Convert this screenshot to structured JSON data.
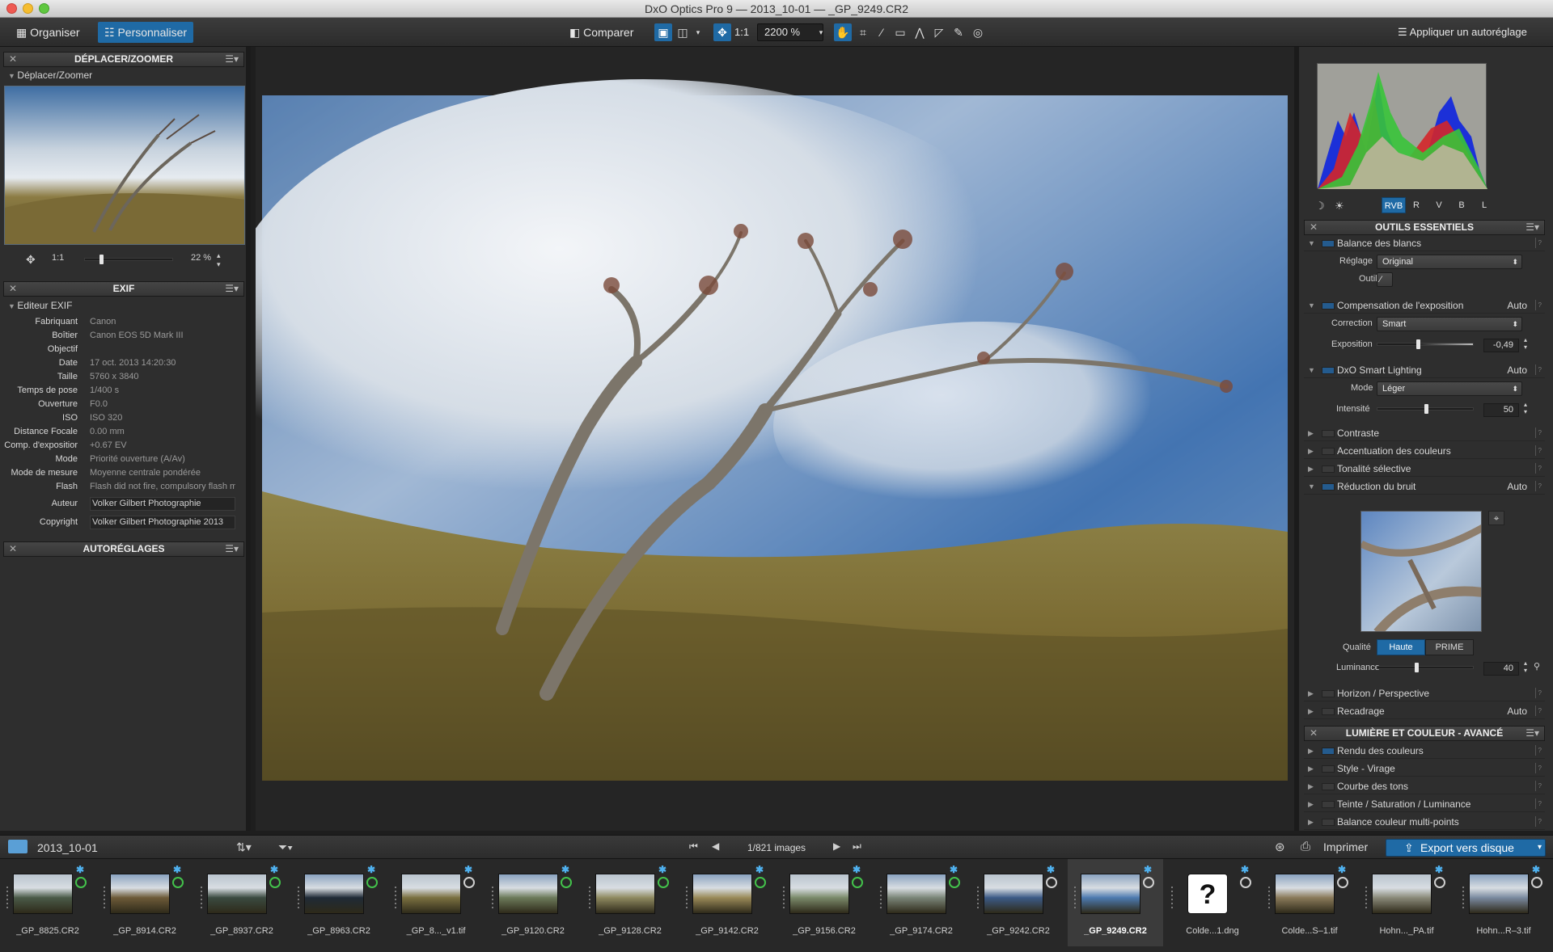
{
  "window": {
    "title": "DxO Optics Pro 9 — 2013_10-01 — _GP_9249.CR2"
  },
  "toolbar": {
    "organize_label": "Organiser",
    "customize_label": "Personnaliser",
    "compare_label": "Comparer",
    "zoom_fit": "1:1",
    "zoom_level": "2200 %",
    "auto_preset_label": "Appliquer un autoréglage"
  },
  "left": {
    "navigator": {
      "title": "DÉPLACER/ZOOMER",
      "sub": "Déplacer/Zoomer",
      "ratio": "1:1",
      "zoom": "22 %"
    },
    "exif": {
      "title": "EXIF",
      "sub": "Editeur EXIF",
      "rows": [
        {
          "k": "Fabriquant",
          "v": "Canon"
        },
        {
          "k": "Boîtier",
          "v": "Canon EOS 5D Mark III"
        },
        {
          "k": "Objectif",
          "v": ""
        },
        {
          "k": "Date",
          "v": "17 oct. 2013 14:20:30"
        },
        {
          "k": "Taille",
          "v": "5760 x 3840"
        },
        {
          "k": "Temps de pose",
          "v": "1/400 s"
        },
        {
          "k": "Ouverture",
          "v": "F0.0"
        },
        {
          "k": "ISO",
          "v": "ISO 320"
        },
        {
          "k": "Distance Focale",
          "v": "0.00 mm"
        },
        {
          "k": "Comp. d'expositior",
          "v": "+0.67 EV"
        },
        {
          "k": "Mode",
          "v": "Priorité ouverture (A/Av)"
        },
        {
          "k": "Mode de mesure",
          "v": "Moyenne centrale pondérée"
        },
        {
          "k": "Flash",
          "v": "Flash did not fire, compulsory flash mode"
        }
      ],
      "author_label": "Auteur",
      "author": "Volker Gilbert Photographie",
      "copyright_label": "Copyright",
      "copyright": "Volker Gilbert Photographie 2013"
    },
    "presets_title": "AUTORÉGLAGES"
  },
  "right": {
    "histogram_tabs": [
      "RVB",
      "R",
      "V",
      "B",
      "L"
    ],
    "essentials": {
      "title": "OUTILS ESSENTIELS",
      "white_balance": {
        "label": "Balance des blancs",
        "setting_label": "Réglage",
        "setting": "Original",
        "tool_label": "Outil"
      },
      "exposure": {
        "label": "Compensation de l'exposition",
        "auto": "Auto",
        "correction_label": "Correction",
        "correction": "Smart",
        "exposure_label": "Exposition",
        "exposure_value": "-0,49",
        "exposure_level": 0.42
      },
      "smart_lighting": {
        "label": "DxO Smart Lighting",
        "auto": "Auto",
        "mode_label": "Mode",
        "mode": "Léger",
        "intensity_label": "Intensité",
        "intensity": "50",
        "intensity_level": 0.5
      },
      "contrast": "Contraste",
      "color_accent": "Accentuation des couleurs",
      "selective_tone": "Tonalité sélective",
      "noise": {
        "label": "Réduction du bruit",
        "auto": "Auto",
        "quality_label": "Qualité",
        "quality_high": "Haute",
        "quality_prime": "PRIME",
        "luminance_label": "Luminance",
        "luminance": "40",
        "luminance_level": 0.4
      },
      "horizon": "Horizon / Perspective",
      "crop": {
        "label": "Recadrage",
        "auto": "Auto"
      }
    },
    "advanced": {
      "title": "LUMIÈRE ET COULEUR - AVANCÉ",
      "items": [
        "Rendu des couleurs",
        "Style - Virage",
        "Courbe des tons",
        "Teinte / Saturation / Luminance",
        "Balance couleur multi-points"
      ]
    }
  },
  "filmbar": {
    "folder": "2013_10-01",
    "count": "1/821 images",
    "print_label": "Imprimer",
    "export_label": "Export vers disque"
  },
  "filmstrip": [
    {
      "name": "_GP_8825.CR2",
      "status": "green"
    },
    {
      "name": "_GP_8914.CR2",
      "status": "green"
    },
    {
      "name": "_GP_8937.CR2",
      "status": "green"
    },
    {
      "name": "_GP_8963.CR2",
      "status": "green"
    },
    {
      "name": "_GP_8..._v1.tif",
      "status": "gray"
    },
    {
      "name": "_GP_9120.CR2",
      "status": "green"
    },
    {
      "name": "_GP_9128.CR2",
      "status": "green"
    },
    {
      "name": "_GP_9142.CR2",
      "status": "green"
    },
    {
      "name": "_GP_9156.CR2",
      "status": "green"
    },
    {
      "name": "_GP_9174.CR2",
      "status": "green"
    },
    {
      "name": "_GP_9242.CR2",
      "status": "gray"
    },
    {
      "name": "_GP_9249.CR2",
      "status": "gray"
    },
    {
      "name": "Colde...1.dng",
      "status": "gray"
    },
    {
      "name": "Colde...S–1.tif",
      "status": "gray"
    },
    {
      "name": "Hohn..._PA.tif",
      "status": "gray"
    },
    {
      "name": "Hohn...R–3.tif",
      "status": "gray"
    }
  ],
  "colors": {
    "accent": "#1f6aa5",
    "status_ok": "#43c24b",
    "star": "#4fb1ef"
  }
}
